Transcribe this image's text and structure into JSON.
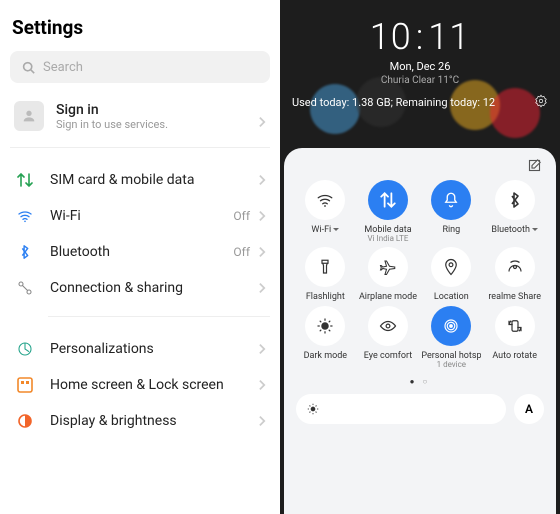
{
  "settings": {
    "title": "Settings",
    "search_placeholder": "Search",
    "signin": {
      "title": "Sign in",
      "sub": "Sign in to use services."
    },
    "rows": [
      {
        "label": "SIM card & mobile data",
        "val": ""
      },
      {
        "label": "Wi-Fi",
        "val": "Off"
      },
      {
        "label": "Bluetooth",
        "val": "Off"
      },
      {
        "label": "Connection & sharing",
        "val": ""
      },
      {
        "label": "Personalizations",
        "val": ""
      },
      {
        "label": "Home screen & Lock screen",
        "val": ""
      },
      {
        "label": "Display & brightness",
        "val": ""
      }
    ]
  },
  "lock": {
    "hour": "10",
    "min": "11",
    "date": "Mon, Dec 26",
    "weather": "Churia Clear 11°C",
    "usage": "Used today: 1.38 GB; Remaining today: 12"
  },
  "tiles": [
    {
      "label": "Wi-Fi",
      "sub": "",
      "dropdown": true
    },
    {
      "label": "Mobile data",
      "sub": "Vi India LTE"
    },
    {
      "label": "Ring",
      "sub": ""
    },
    {
      "label": "Bluetooth",
      "sub": "",
      "dropdown": true
    },
    {
      "label": "Flashlight"
    },
    {
      "label": "Airplane mode"
    },
    {
      "label": "Location"
    },
    {
      "label": "realme Share"
    },
    {
      "label": "Dark mode"
    },
    {
      "label": "Eye comfort"
    },
    {
      "label": "Personal hotspot",
      "sub": "1 device"
    },
    {
      "label": "Auto rotate"
    }
  ],
  "auto": "A"
}
